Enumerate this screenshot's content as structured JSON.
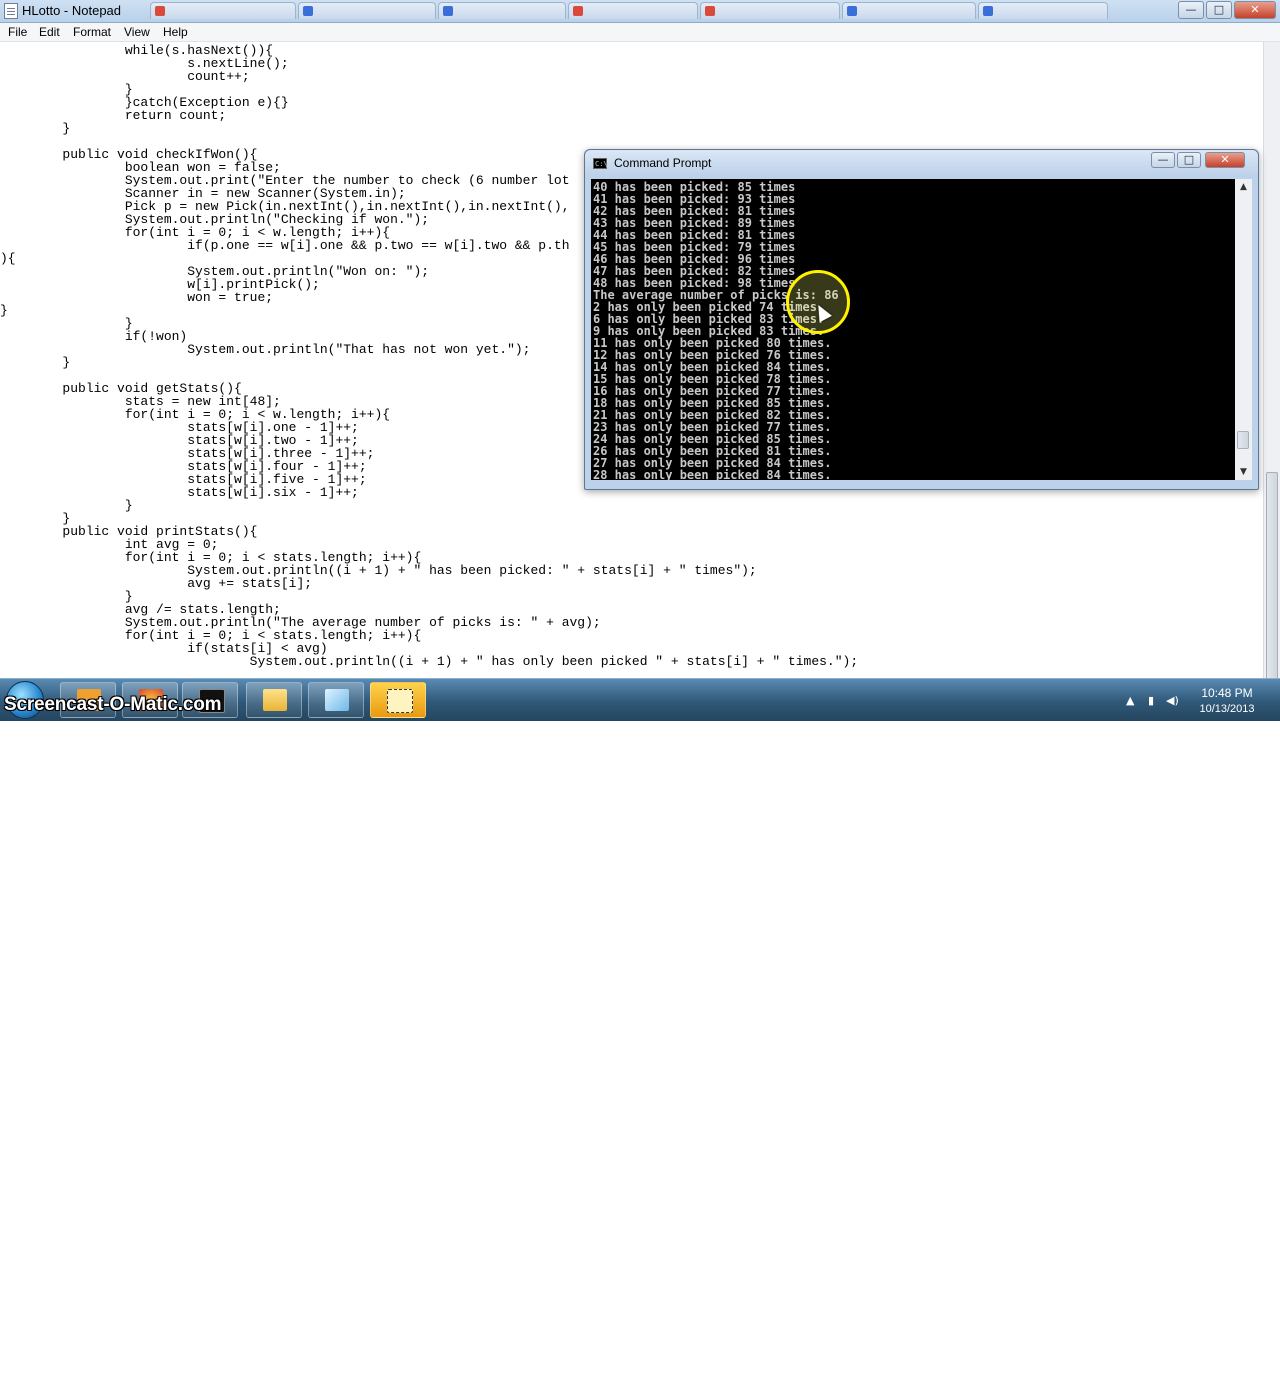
{
  "notepad": {
    "title": "HLotto - Notepad",
    "menu": [
      "File",
      "Edit",
      "Format",
      "View",
      "Help"
    ],
    "code_lines": [
      "                while(s.hasNext()){",
      "                        s.nextLine();",
      "                        count++;",
      "                }",
      "                }catch(Exception e){}",
      "                return count;",
      "        }",
      "",
      "        public void checkIfWon(){",
      "                boolean won = false;",
      "                System.out.print(\"Enter the number to check (6 number lot",
      "                Scanner in = new Scanner(System.in);",
      "                Pick p = new Pick(in.nextInt(),in.nextInt(),in.nextInt(),",
      "                System.out.println(\"Checking if won.\");",
      "                for(int i = 0; i < w.length; i++){",
      "                        if(p.one == w[i].one && p.two == w[i].two && p.th",
      "){",
      "                        System.out.println(\"Won on: \");",
      "                        w[i].printPick();",
      "                        won = true;",
      "}",
      "                }",
      "                if(!won)",
      "                        System.out.println(\"That has not won yet.\");",
      "        }",
      "",
      "        public void getStats(){",
      "                stats = new int[48];",
      "                for(int i = 0; i < w.length; i++){",
      "                        stats[w[i].one - 1]++;",
      "                        stats[w[i].two - 1]++;",
      "                        stats[w[i].three - 1]++;",
      "                        stats[w[i].four - 1]++;",
      "                        stats[w[i].five - 1]++;",
      "                        stats[w[i].six - 1]++;",
      "                }",
      "        }",
      "        public void printStats(){",
      "                int avg = 0;",
      "                for(int i = 0; i < stats.length; i++){",
      "                        System.out.println((i + 1) + \" has been picked: \" + stats[i] + \" times\");",
      "                        avg += stats[i];",
      "                }",
      "                avg /= stats.length;",
      "                System.out.println(\"The average number of picks is: \" + avg);",
      "                for(int i = 0; i < stats.length; i++){",
      "                        if(stats[i] < avg)",
      "                                System.out.println((i + 1) + \" has only been picked \" + stats[i] + \" times.\");"
    ]
  },
  "cmd": {
    "title": "Command Prompt",
    "icon_text": "C:\\",
    "lines": [
      "40 has been picked: 85 times",
      "41 has been picked: 93 times",
      "42 has been picked: 81 times",
      "43 has been picked: 89 times",
      "44 has been picked: 81 times",
      "45 has been picked: 79 times",
      "46 has been picked: 96 times",
      "47 has been picked: 82 times",
      "48 has been picked: 98 times",
      "The average number of picks is: 86",
      "2 has only been picked 74 times.",
      "6 has only been picked 83 times.",
      "9 has only been picked 83 times.",
      "11 has only been picked 80 times.",
      "12 has only been picked 76 times.",
      "14 has only been picked 84 times.",
      "15 has only been picked 78 times.",
      "16 has only been picked 77 times.",
      "18 has only been picked 85 times.",
      "21 has only been picked 82 times.",
      "23 has only been picked 77 times.",
      "24 has only been picked 85 times.",
      "26 has only been picked 81 times.",
      "27 has only been picked 84 times.",
      "28 has only been picked 84 times."
    ]
  },
  "window_controls": {
    "minimize": "—",
    "maximize": "□",
    "close": "✕"
  },
  "taskbar": {
    "watermark": "Screencast-O-Matic.com",
    "time": "10:48 PM",
    "date": "10/13/2013",
    "tray_icons": [
      "show-hidden-icon",
      "network-icon",
      "speaker-icon",
      "flag-icon"
    ],
    "tray_glyphs": [
      "▲",
      "▮",
      "◀)",
      "⚑"
    ]
  },
  "colors": {
    "console_bg": "#000000",
    "console_text": "#c8c8c8",
    "highlight_ring": "#fff200"
  }
}
